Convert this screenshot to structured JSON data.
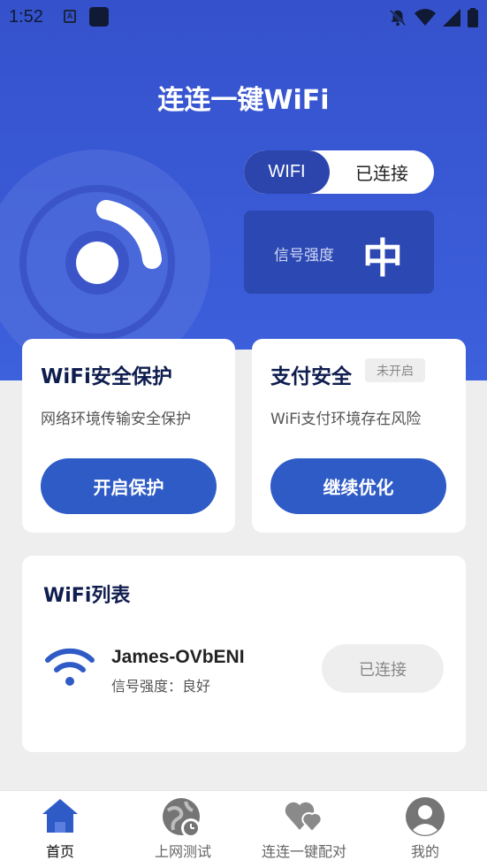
{
  "status_bar": {
    "time": "1:52",
    "a_icon": "A"
  },
  "app": {
    "title": "连连一键WiFi"
  },
  "connection": {
    "left_label": "WIFI",
    "right_label": "已连接"
  },
  "signal": {
    "label": "信号强度",
    "value": "中"
  },
  "cards": [
    {
      "title": "WiFi安全保护",
      "desc": "网络环境传输安全保护",
      "button": "开启保护"
    },
    {
      "title": "支付安全",
      "tag": "未开启",
      "desc": "WiFi支付环境存在风险",
      "button": "继续优化"
    }
  ],
  "wifi_list": {
    "title": "WiFi列表",
    "items": [
      {
        "ssid": "James-OVbENI",
        "signal": "信号强度：良好",
        "action": "已连接"
      }
    ]
  },
  "tabs": [
    {
      "label": "首页",
      "icon": "home-icon",
      "active": true
    },
    {
      "label": "上网测试",
      "icon": "speedtest-icon"
    },
    {
      "label": "连连一键配对",
      "icon": "hearts-icon"
    },
    {
      "label": "我的",
      "icon": "profile-icon"
    }
  ],
  "colors": {
    "primary": "#2f5bc6",
    "hero": "#3552cc",
    "dark_text": "#0f1d4f"
  }
}
